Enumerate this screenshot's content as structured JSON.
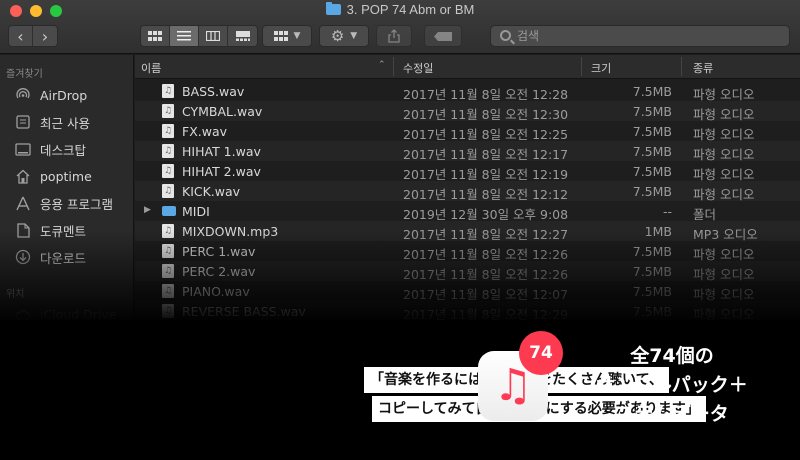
{
  "window": {
    "title": "3. POP 74 Abm or BM"
  },
  "toolbar": {
    "search_placeholder": "검색"
  },
  "sidebar": {
    "favorites_header": "즐겨찾기",
    "items": [
      {
        "label": "AirDrop",
        "icon": "airdrop-icon"
      },
      {
        "label": "최근 사용",
        "icon": "recents-icon"
      },
      {
        "label": "데스크탑",
        "icon": "desktop-icon"
      },
      {
        "label": "poptime",
        "icon": "home-icon"
      },
      {
        "label": "응용 프로그램",
        "icon": "applications-icon"
      },
      {
        "label": "도큐멘트",
        "icon": "documents-icon"
      },
      {
        "label": "다운로드",
        "icon": "downloads-icon"
      }
    ],
    "locations_header": "위치",
    "locations": [
      {
        "label": "iCloud Drive",
        "icon": "cloud-icon"
      }
    ]
  },
  "columns": {
    "name": "이름",
    "date": "수정일",
    "size": "크기",
    "kind": "종류"
  },
  "files": [
    {
      "name": "BASS.wav",
      "date": "2017년 11월 8일 오전 12:28",
      "size": "7.5MB",
      "kind": "파형 오디오"
    },
    {
      "name": "CYMBAL.wav",
      "date": "2017년 11월 8일 오전 12:30",
      "size": "7.5MB",
      "kind": "파형 오디오"
    },
    {
      "name": "FX.wav",
      "date": "2017년 11월 8일 오전 12:25",
      "size": "7.5MB",
      "kind": "파형 오디오"
    },
    {
      "name": "HIHAT 1.wav",
      "date": "2017년 11월 8일 오전 12:17",
      "size": "7.5MB",
      "kind": "파형 오디오"
    },
    {
      "name": "HIHAT 2.wav",
      "date": "2017년 11월 8일 오전 12:19",
      "size": "7.5MB",
      "kind": "파형 오디오"
    },
    {
      "name": "KICK.wav",
      "date": "2017년 11월 8일 오전 12:12",
      "size": "7.5MB",
      "kind": "파형 오디오"
    },
    {
      "name": "MIDI",
      "date": "2019년 12월 30일 오후 9:08",
      "size": "--",
      "kind": "폴더"
    },
    {
      "name": "MIXDOWN.mp3",
      "date": "2017년 11월 8일 오전 12:27",
      "size": "1MB",
      "kind": "MP3 오디오"
    },
    {
      "name": "PERC 1.wav",
      "date": "2017년 11월 8일 오전 12:26",
      "size": "7.5MB",
      "kind": "파형 오디오"
    },
    {
      "name": "PERC 2.wav",
      "date": "2017년 11월 8일 오전 12:26",
      "size": "7.5MB",
      "kind": "파형 오디오"
    },
    {
      "name": "PIANO.wav",
      "date": "2017년 11월 8일 오전 12:07",
      "size": "7.5MB",
      "kind": "파형 오디오"
    },
    {
      "name": "REVERSE BASS.wav",
      "date": "2017년 11월 8일 오전 12:29",
      "size": "7.5MB",
      "kind": "파형 오디오"
    }
  ],
  "banner": {
    "quote_line1": "「音楽を作るには、いい曲をたくさん聴いて、",
    "quote_line2": "コピーしてみて自分のものにする必要があります」",
    "badge": "74",
    "promo_line1": "全74個の",
    "promo_line2": "サンプルパック＋",
    "promo_line3": "ステムデータ"
  },
  "colors": {
    "accent_red": "#fd3a4f",
    "folder_blue": "#5aa7e6"
  }
}
